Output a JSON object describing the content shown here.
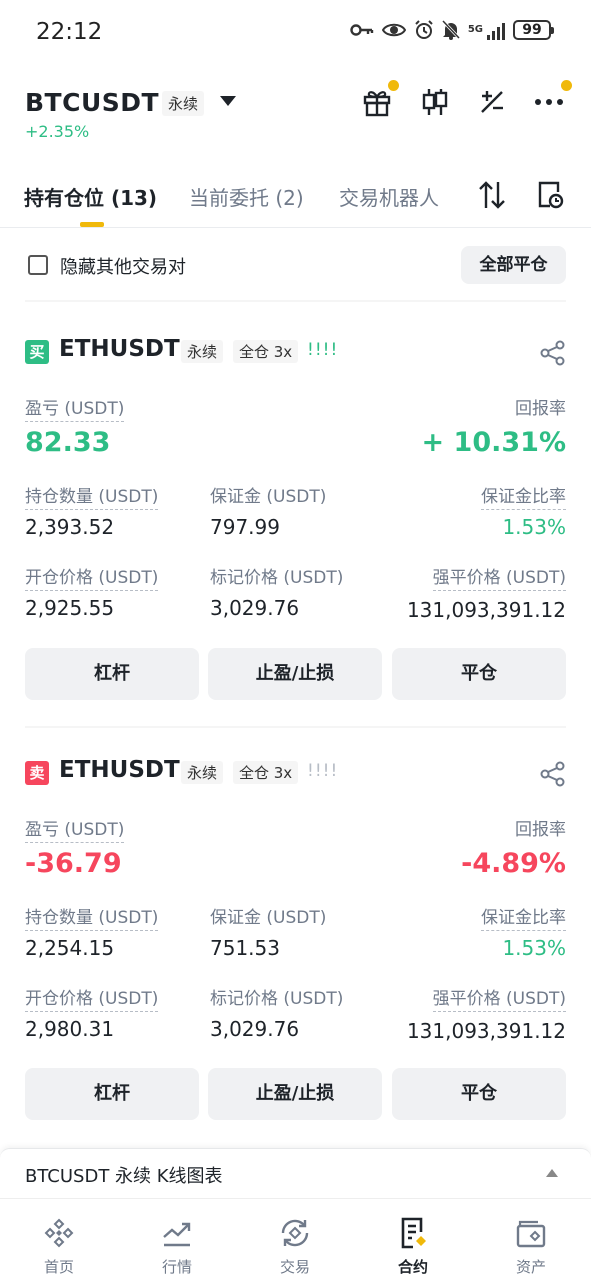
{
  "status_bar": {
    "time": "22:12",
    "network": "5G",
    "battery": "99"
  },
  "header": {
    "symbol": "BTCUSDT",
    "contract_type": "永续",
    "change": "+2.35%",
    "colors": {
      "up": "#2ebd85",
      "down": "#f6465d",
      "accent": "#f0b90b"
    }
  },
  "tabs": [
    {
      "label": "持有仓位 (13)",
      "active": true
    },
    {
      "label": "当前委托 (2)",
      "active": false
    },
    {
      "label": "交易机器人",
      "active": false
    }
  ],
  "filter": {
    "hide_other_label": "隐藏其他交易对",
    "close_all_label": "全部平仓"
  },
  "positions": [
    {
      "side_label": "买",
      "side_color": "#2ebd85",
      "pair": "ETHUSDT",
      "contract_type": "永续",
      "margin_mode": "全仓 3x",
      "strength": "!!!!",
      "pnl_label": "盈亏 (USDT)",
      "pnl": "82.33",
      "roe_label": "回报率",
      "roe": "+ 10.31%",
      "size_label": "持仓数量 (USDT)",
      "size": "2,393.52",
      "margin_label": "保证金 (USDT)",
      "margin": "797.99",
      "margin_ratio_label": "保证金比率",
      "margin_ratio": "1.53%",
      "entry_label": "开仓价格 (USDT)",
      "entry": "2,925.55",
      "mark_label": "标记价格 (USDT)",
      "mark": "3,029.76",
      "liq_label": "强平价格 (USDT)",
      "liq": "131,093,391.12",
      "btn_leverage": "杠杆",
      "btn_tpsl": "止盈/止损",
      "btn_close": "平仓"
    },
    {
      "side_label": "卖",
      "side_color": "#f6465d",
      "pair": "ETHUSDT",
      "contract_type": "永续",
      "margin_mode": "全仓 3x",
      "strength": "!!!!",
      "pnl_label": "盈亏 (USDT)",
      "pnl": "-36.79",
      "roe_label": "回报率",
      "roe": "-4.89%",
      "size_label": "持仓数量 (USDT)",
      "size": "2,254.15",
      "margin_label": "保证金 (USDT)",
      "margin": "751.53",
      "margin_ratio_label": "保证金比率",
      "margin_ratio": "1.53%",
      "entry_label": "开仓价格 (USDT)",
      "entry": "2,980.31",
      "mark_label": "标记价格 (USDT)",
      "mark": "3,029.76",
      "liq_label": "强平价格 (USDT)",
      "liq": "131,093,391.12",
      "btn_leverage": "杠杆",
      "btn_tpsl": "止盈/止损",
      "btn_close": "平仓"
    }
  ],
  "kline_bar": {
    "label": "BTCUSDT 永续 K线图表"
  },
  "bottom_nav": [
    {
      "label": "首页",
      "icon": "home-icon",
      "active": false
    },
    {
      "label": "行情",
      "icon": "markets-icon",
      "active": false
    },
    {
      "label": "交易",
      "icon": "trade-icon",
      "active": false
    },
    {
      "label": "合约",
      "icon": "futures-icon",
      "active": true
    },
    {
      "label": "资产",
      "icon": "wallet-icon",
      "active": false
    }
  ]
}
